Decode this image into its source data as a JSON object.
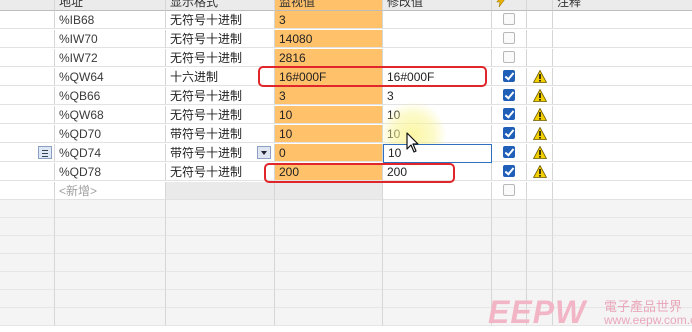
{
  "header": {
    "address": "地址",
    "display_format": "显示格式",
    "monitor_value": "监视值",
    "modify_value": "修改值",
    "modify_icon": "lightning-icon",
    "comment": "注释"
  },
  "rows": [
    {
      "address": "%IB68",
      "format": "无符号十进制",
      "monitor": "3",
      "modify": "",
      "checked": false,
      "warning": false
    },
    {
      "address": "%IW70",
      "format": "无符号十进制",
      "monitor": "14080",
      "modify": "",
      "checked": false,
      "warning": false
    },
    {
      "address": "%IW72",
      "format": "无符号十进制",
      "monitor": "2816",
      "modify": "",
      "checked": false,
      "warning": false
    },
    {
      "address": "%QW64",
      "format": "十六进制",
      "monitor": "16#000F",
      "modify": "16#000F",
      "checked": true,
      "warning": true
    },
    {
      "address": "%QB66",
      "format": "无符号十进制",
      "monitor": "3",
      "modify": "3",
      "checked": true,
      "warning": true
    },
    {
      "address": "%QW68",
      "format": "无符号十进制",
      "monitor": "10",
      "modify": "10",
      "checked": true,
      "warning": true
    },
    {
      "address": "%QD70",
      "format": "带符号十进制",
      "monitor": "10",
      "modify": "10",
      "checked": true,
      "warning": true
    },
    {
      "address": "%QD74",
      "format": "带符号十进制",
      "monitor": "0",
      "modify": "10",
      "checked": true,
      "warning": true
    },
    {
      "address": "%QD78",
      "format": "无符号十进制",
      "monitor": "200",
      "modify": "200",
      "checked": true,
      "warning": true
    }
  ],
  "new_row_label": "<新增>",
  "watermark": {
    "brand": "EEPW",
    "cn": "電子產品世界",
    "url": "www.eepw.com.cn"
  },
  "colors": {
    "monitor_bg": "#ffc16a",
    "highlight": "#e0262b",
    "checkbox": "#1f5fb8"
  }
}
